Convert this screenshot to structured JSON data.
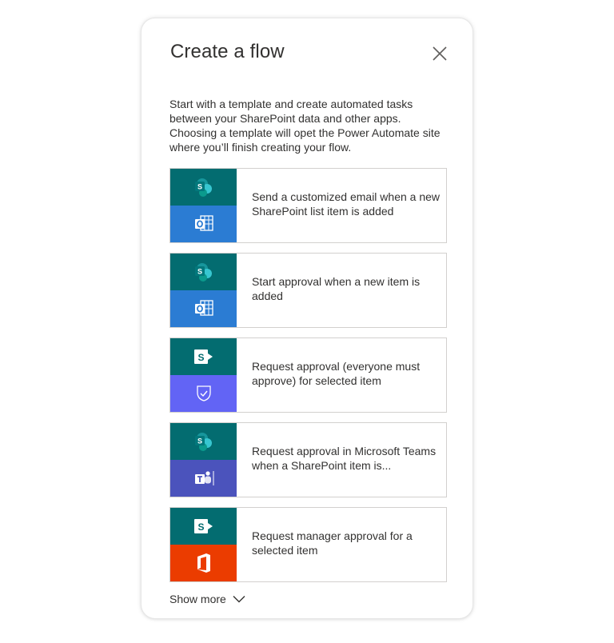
{
  "dialog": {
    "title": "Create a flow",
    "description": "Start with a template and create automated tasks between your SharePoint data and other apps. Choosing a template will opet the Power Automate site where you’ll finish creating your flow.",
    "show_more_label": "Show more"
  },
  "colors": {
    "sharepoint": "#036c70",
    "outlook": "#2b7cd3",
    "approvals": "#6264f5",
    "teams": "#4b53bc",
    "office": "#eb3c00"
  },
  "templates": [
    {
      "label": "Send a customized email when a new SharePoint list item is added",
      "top_icon": "sharepoint-icon",
      "bottom_icon": "outlook-icon",
      "bottom_color": "#2b7cd3"
    },
    {
      "label": "Start approval when a new item is added",
      "top_icon": "sharepoint-icon",
      "bottom_icon": "outlook-icon",
      "bottom_color": "#2b7cd3"
    },
    {
      "label": "Request approval (everyone must approve) for selected item",
      "top_icon": "sharepoint-classic-icon",
      "bottom_icon": "approvals-icon",
      "bottom_color": "#6264f5"
    },
    {
      "label": "Request approval in Microsoft Teams when a SharePoint item is...",
      "top_icon": "sharepoint-icon",
      "bottom_icon": "teams-icon",
      "bottom_color": "#4b53bc"
    },
    {
      "label": "Request manager approval for a selected item",
      "top_icon": "sharepoint-classic-icon",
      "bottom_icon": "office-icon",
      "bottom_color": "#eb3c00"
    }
  ]
}
